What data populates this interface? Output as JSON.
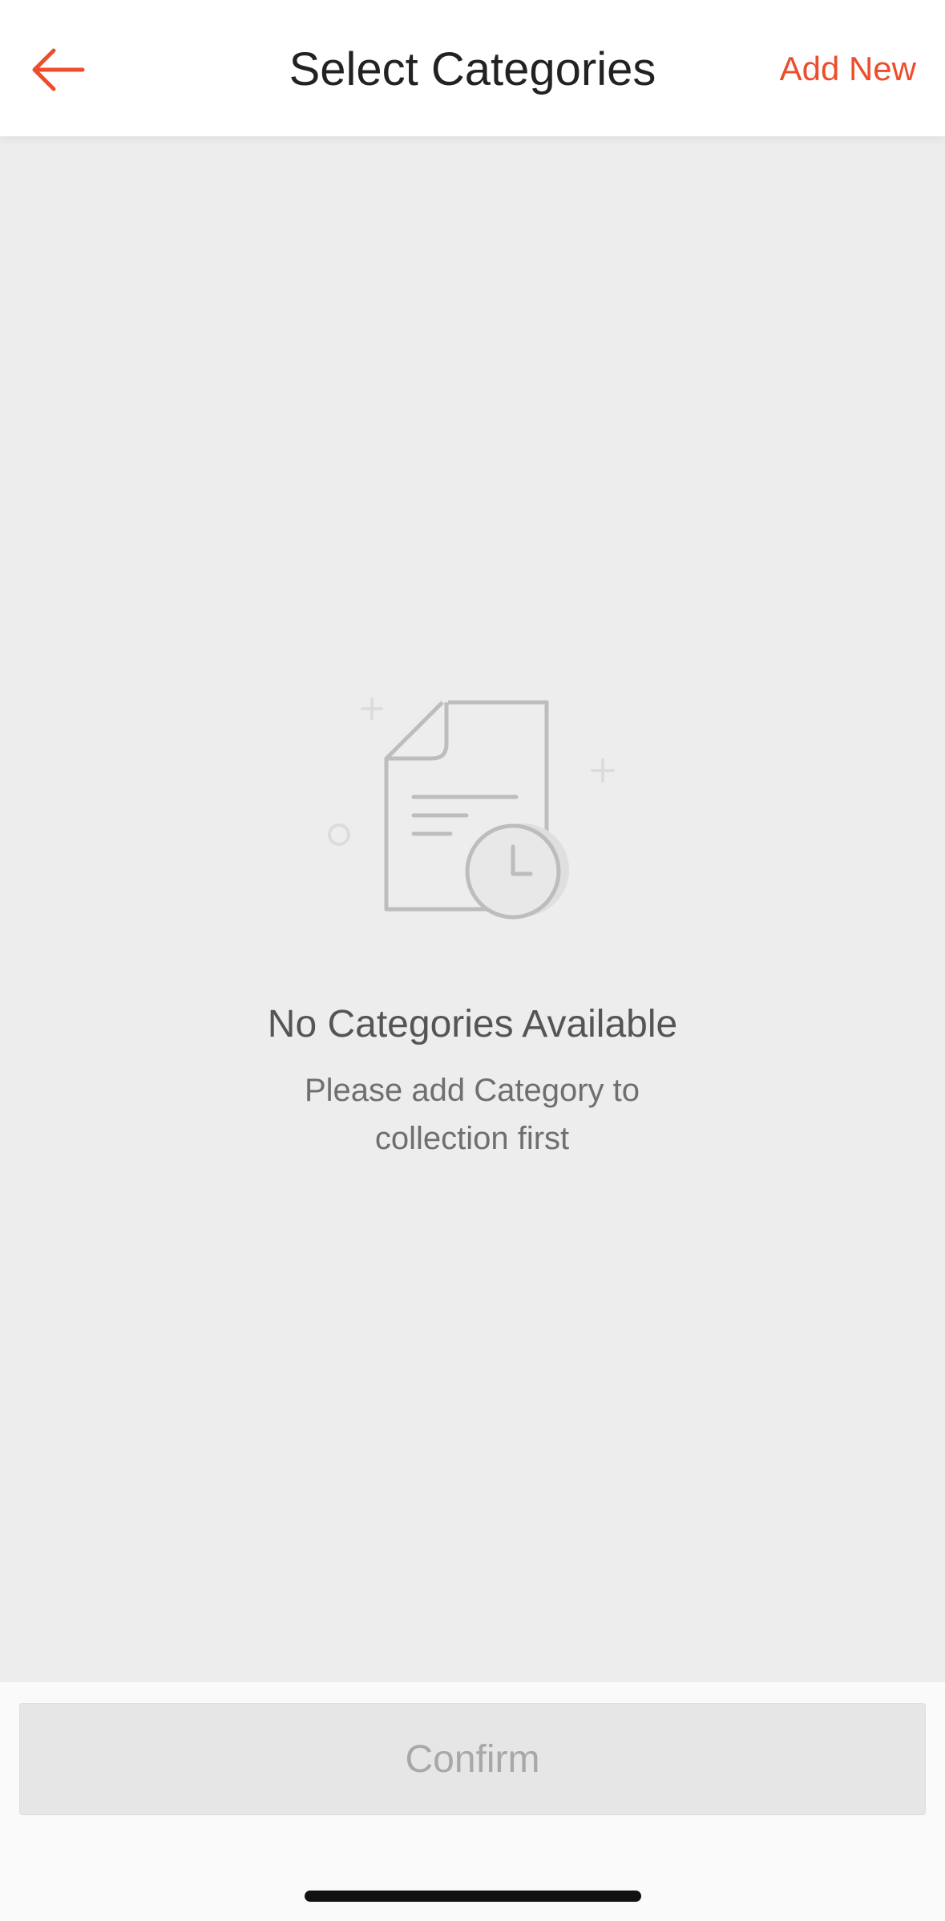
{
  "header": {
    "title": "Select Categories",
    "add_new_label": "Add New",
    "back_icon": "arrow-left-icon",
    "accent_color": "#ee4d2d"
  },
  "empty_state": {
    "icon": "document-clock-icon",
    "title": "No Categories Available",
    "subtitle": "Please add Category to collection first"
  },
  "footer": {
    "confirm_label": "Confirm",
    "confirm_enabled": false
  }
}
